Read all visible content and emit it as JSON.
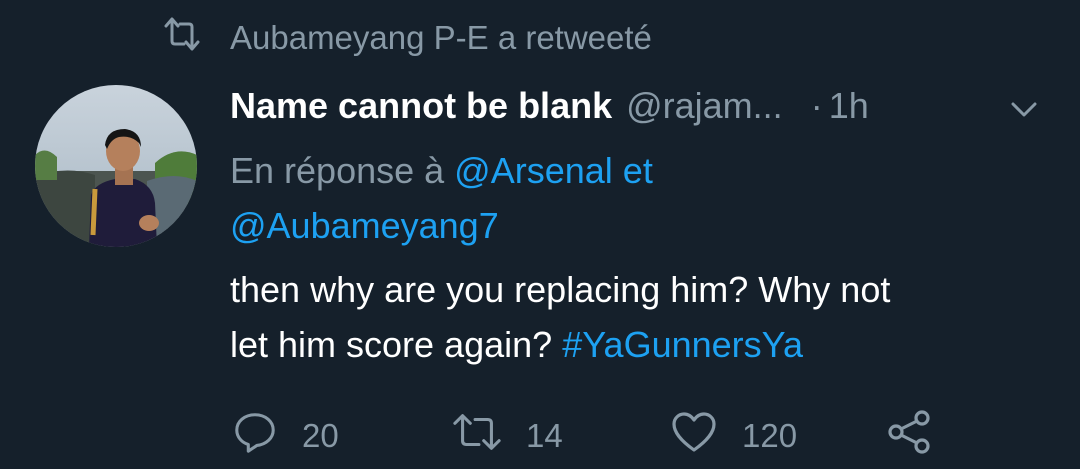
{
  "retweet": {
    "text": "Aubameyang P-E a retweeté",
    "icon": "retweet-icon"
  },
  "tweet": {
    "author_name": "Name cannot be blank",
    "handle": "@rajam...",
    "separator": "·",
    "time": "1h",
    "reply_prefix": "En réponse à",
    "reply_mention_1": "@Arsenal",
    "reply_joiner": "et",
    "reply_mention_2": "@Aubameyang7",
    "text_line_1": "then why are you replacing him? Why not",
    "text_line_2": "let him score again?",
    "hashtag": "#YaGunnersYa"
  },
  "actions": {
    "reply_count": "20",
    "retweet_count": "14",
    "like_count": "120"
  },
  "colors": {
    "background": "#15202b",
    "secondary_text": "#8899a6",
    "link": "#1da1f2"
  }
}
